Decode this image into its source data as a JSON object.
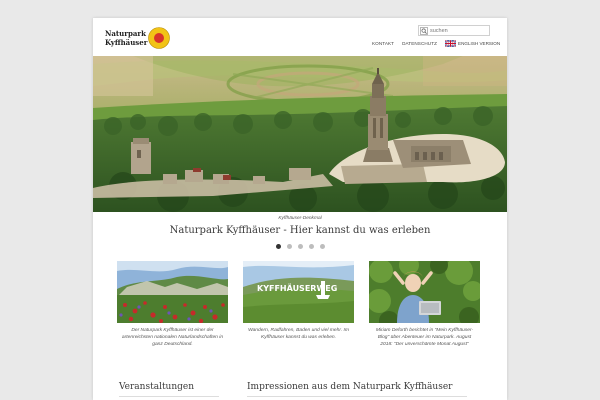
{
  "header": {
    "logo_line1": "Naturpark",
    "logo_line2": "Kyffhäuser",
    "search_placeholder": "suchen",
    "nav": [
      "KONTAKT",
      "DATENSCHUTZ"
    ],
    "english_label": "ENGLISH VERSION"
  },
  "hero": {
    "caption": "Kyffhäuser-Denkmal",
    "tagline": "Naturpark Kyffhäuser - Hier kannst du was erleben",
    "slides": 5,
    "active_slide": 1
  },
  "teasers": [
    {
      "text": "Der Naturpark Kyffhäuser ist einer der artenreichsten nationalen Naturlandschaften in ganz Deutschland."
    },
    {
      "overlay": "KYFFHÄUSERWEG",
      "text": "Wandern, Radfahren, Baden und viel mehr. Im Kyffhäuser kannst du was erleben."
    },
    {
      "text": "Miriam Deforth berichtet in \"Mein Kyffhäuser-Blog\" über Abenteuer im Naturpark.  August 2018: \"Der unverschämte Monat August\""
    }
  ],
  "sections": {
    "events": "Veranstaltungen",
    "impressions": "Impressionen aus dem Naturpark Kyffhäuser"
  },
  "colors": {
    "background": "#e9e9e9",
    "logo_yellow": "#f2c316",
    "logo_red": "#d8342a",
    "active_dot": "#333333",
    "dot": "#bdbdbd"
  }
}
